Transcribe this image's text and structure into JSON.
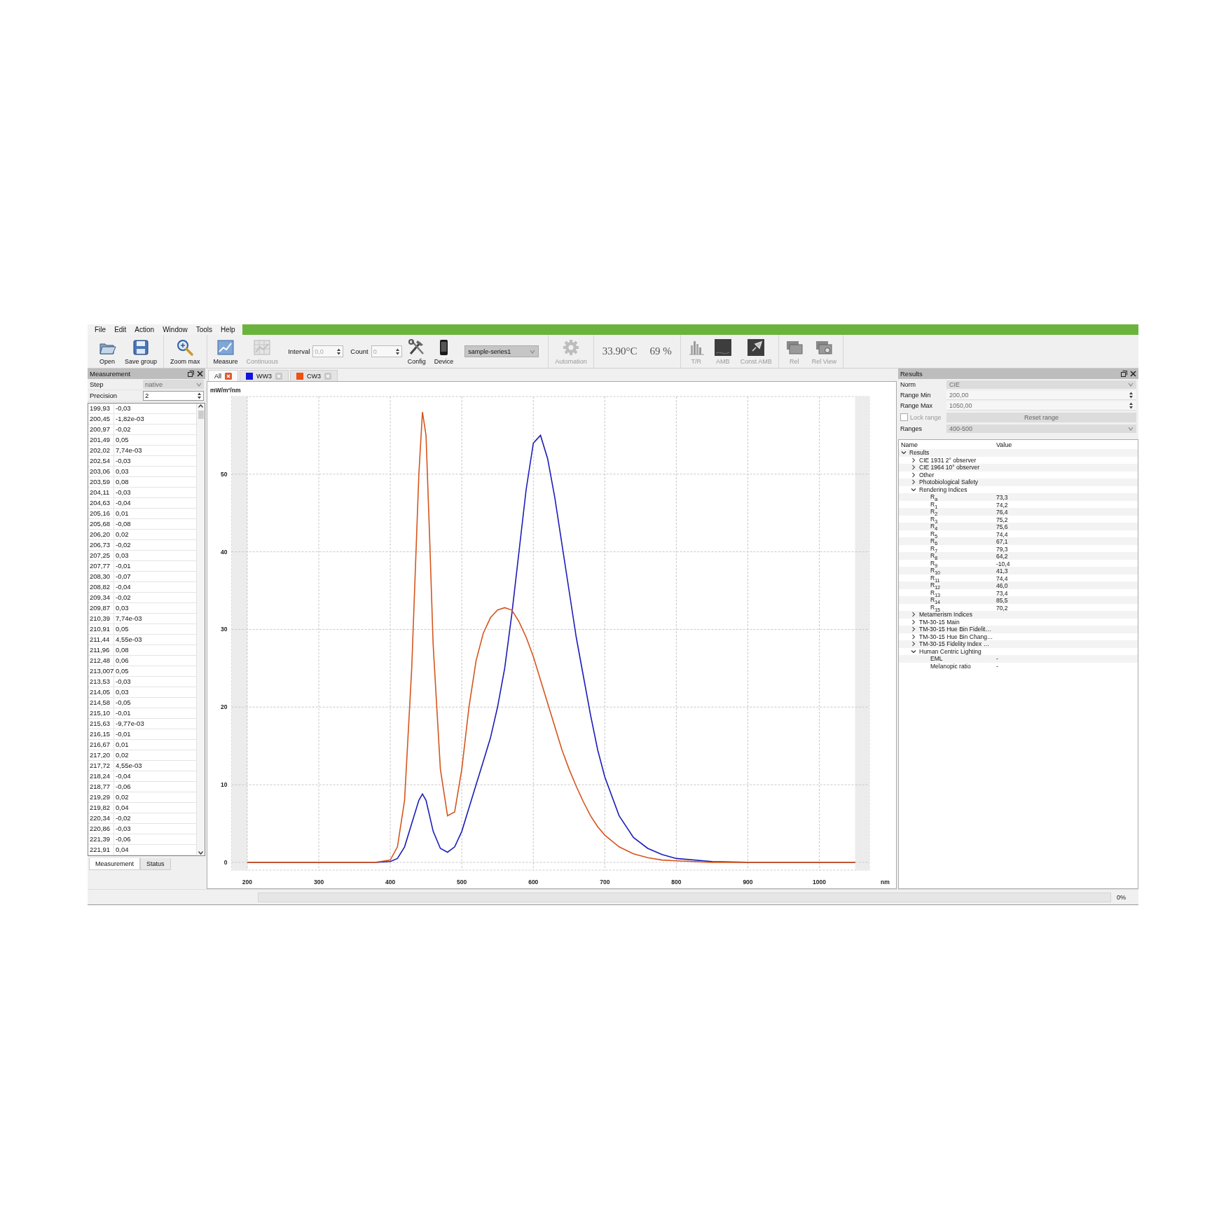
{
  "menu": [
    "File",
    "Edit",
    "Action",
    "Window",
    "Tools",
    "Help"
  ],
  "toolbar": [
    [
      {
        "kind": "button",
        "label": "Open",
        "disabled": false
      },
      {
        "kind": "button",
        "label": "Save group",
        "disabled": false
      }
    ],
    [
      {
        "kind": "button",
        "label": "Zoom max",
        "disabled": false
      }
    ],
    [
      {
        "kind": "button",
        "label": "Measure",
        "disabled": false
      },
      {
        "kind": "button",
        "label": "Continuous",
        "disabled": true
      },
      {
        "kind": "spin",
        "label": "Interval",
        "value": "0,0",
        "disabled": true
      },
      {
        "kind": "spin",
        "label": "Count",
        "value": "0",
        "disabled": true
      },
      {
        "kind": "button",
        "label": "Config",
        "disabled": false
      },
      {
        "kind": "button",
        "label": "Device",
        "disabled": false
      },
      {
        "kind": "combo",
        "value": "sample-series1"
      }
    ],
    [
      {
        "kind": "button",
        "label": "Automation",
        "disabled": true
      }
    ],
    [
      {
        "kind": "reading",
        "text": "33.90°C"
      },
      {
        "kind": "reading",
        "text": "69 %"
      }
    ],
    [
      {
        "kind": "button",
        "label": "T/R",
        "disabled": true
      },
      {
        "kind": "button",
        "label": "AMB",
        "disabled": true
      },
      {
        "kind": "button",
        "label": "Const AMB",
        "disabled": true
      }
    ],
    [
      {
        "kind": "button",
        "label": "Rel",
        "disabled": true
      },
      {
        "kind": "button",
        "label": "Rel View",
        "disabled": true
      }
    ]
  ],
  "measurement": {
    "title": "Measurement",
    "step_label": "Step",
    "step": "native",
    "precision_label": "Precision",
    "precision": "2",
    "rows": [
      [
        "199,93",
        "-0,03"
      ],
      [
        "200,45",
        "-1,82e-03"
      ],
      [
        "200,97",
        "-0,02"
      ],
      [
        "201,49",
        "0,05"
      ],
      [
        "202,02",
        "7,74e-03"
      ],
      [
        "202,54",
        "-0,03"
      ],
      [
        "203,06",
        "0,03"
      ],
      [
        "203,59",
        "0,08"
      ],
      [
        "204,11",
        "-0,03"
      ],
      [
        "204,63",
        "-0,04"
      ],
      [
        "205,16",
        "0,01"
      ],
      [
        "205,68",
        "-0,08"
      ],
      [
        "206,20",
        "0,02"
      ],
      [
        "206,73",
        "-0,02"
      ],
      [
        "207,25",
        "0,03"
      ],
      [
        "207,77",
        "-0,01"
      ],
      [
        "208,30",
        "-0,07"
      ],
      [
        "208,82",
        "-0,04"
      ],
      [
        "209,34",
        "-0,02"
      ],
      [
        "209,87",
        "0,03"
      ],
      [
        "210,39",
        "7,74e-03"
      ],
      [
        "210,91",
        "0,05"
      ],
      [
        "211,44",
        "4,55e-03"
      ],
      [
        "211,96",
        "0,08"
      ],
      [
        "212,48",
        "0,06"
      ],
      [
        "213,007",
        "0,05"
      ],
      [
        "213,53",
        "-0,03"
      ],
      [
        "214,05",
        "0,03"
      ],
      [
        "214,58",
        "-0,05"
      ],
      [
        "215,10",
        "-0,01"
      ],
      [
        "215,63",
        "-9,77e-03"
      ],
      [
        "216,15",
        "-0,01"
      ],
      [
        "216,67",
        "0,01"
      ],
      [
        "217,20",
        "0,02"
      ],
      [
        "217,72",
        "4,55e-03"
      ],
      [
        "218,24",
        "-0,04"
      ],
      [
        "218,77",
        "-0,06"
      ],
      [
        "219,29",
        "0,02"
      ],
      [
        "219,82",
        "0,04"
      ],
      [
        "220,34",
        "-0,02"
      ],
      [
        "220,86",
        "-0,03"
      ],
      [
        "221,39",
        "-0,06"
      ],
      [
        "221,91",
        "0,04"
      ]
    ],
    "tabs": [
      {
        "label": "Measurement",
        "selected": true
      },
      {
        "label": "Status",
        "selected": false
      }
    ]
  },
  "chart_tabs": [
    {
      "label": "All",
      "selected": true
    },
    {
      "label": "WW3",
      "selected": false,
      "color": "#1010e0"
    },
    {
      "label": "CW3",
      "selected": false,
      "color": "#f05010"
    }
  ],
  "chart": {
    "chart_data": {
      "type": "line",
      "ylabel": "mW/m²/nm",
      "xlabel": "nm",
      "x": [
        200,
        300,
        380,
        400,
        410,
        420,
        430,
        440,
        445,
        450,
        455,
        460,
        470,
        480,
        490,
        500,
        510,
        520,
        530,
        540,
        550,
        560,
        570,
        580,
        590,
        600,
        610,
        620,
        630,
        640,
        650,
        660,
        670,
        680,
        690,
        700,
        720,
        740,
        760,
        780,
        800,
        850,
        900,
        1000,
        1050
      ],
      "series": [
        {
          "color": "#1c1cb8",
          "values": [
            0,
            0,
            0,
            0.1,
            0.5,
            2,
            5,
            8,
            8.8,
            8,
            6,
            4,
            1.8,
            1.3,
            2,
            4,
            7,
            10,
            13,
            16,
            20,
            25,
            32,
            40,
            48,
            54,
            55,
            52,
            47,
            41,
            35,
            29,
            24,
            19,
            14.5,
            11,
            6,
            3.2,
            1.8,
            1,
            0.5,
            0.1,
            0,
            0,
            0
          ]
        },
        {
          "color": "#d4561e",
          "values": [
            0,
            0,
            0,
            0.3,
            2,
            8,
            25,
            50,
            58,
            55,
            42,
            28,
            12,
            6,
            6.5,
            12,
            20,
            26,
            29.5,
            31.5,
            32.5,
            32.8,
            32.5,
            31,
            29,
            26.5,
            23.5,
            20.5,
            17.5,
            14.5,
            12,
            9.8,
            7.8,
            6,
            4.6,
            3.5,
            2,
            1.1,
            0.6,
            0.3,
            0.2,
            0,
            0,
            0,
            0
          ]
        }
      ],
      "grid": true,
      "xlim": [
        178,
        1070
      ],
      "ylim": [
        -1,
        60
      ],
      "xticks": [
        200,
        300,
        400,
        500,
        600,
        700,
        800,
        900,
        1000
      ],
      "yticks": [
        0,
        10,
        20,
        30,
        40,
        50
      ]
    }
  },
  "results": {
    "title": "Results",
    "form": [
      {
        "kind": "combo",
        "label": "Norm",
        "value": "CIE"
      },
      {
        "kind": "spin",
        "label": "Range Min",
        "value": "200,00"
      },
      {
        "kind": "spin",
        "label": "Range Max",
        "value": "1050,00"
      },
      {
        "kind": "check",
        "label": "Lock range",
        "checked": false,
        "button": "Reset range"
      },
      {
        "kind": "combo",
        "label": "Ranges",
        "value": "400-500"
      }
    ],
    "columns": [
      "Name",
      "Value"
    ],
    "tree": [
      {
        "name": "Results",
        "expanded": true,
        "children": [
          {
            "name": "CIE 1931 2° observer",
            "expanded": false
          },
          {
            "name": "CIE 1964 10° observer",
            "expanded": false
          },
          {
            "name": "Other",
            "expanded": false
          },
          {
            "name": "Photobiological Safety",
            "expanded": false
          },
          {
            "name": "Rendering Indices",
            "expanded": true,
            "children": [
              {
                "name": "R$_{a}$",
                "value": "73,3"
              },
              {
                "name": "R$_{1}$",
                "value": "74,2"
              },
              {
                "name": "R$_{2}$",
                "value": "76,4"
              },
              {
                "name": "R$_{3}$",
                "value": "75,2"
              },
              {
                "name": "R$_{4}$",
                "value": "75,6"
              },
              {
                "name": "R$_{5}$",
                "value": "74,4"
              },
              {
                "name": "R$_{6}$",
                "value": "67,1"
              },
              {
                "name": "R$_{7}$",
                "value": "79,3"
              },
              {
                "name": "R$_{8}$",
                "value": "64,2"
              },
              {
                "name": "R$_{9}$",
                "value": "-10,4"
              },
              {
                "name": "R$_{10}$",
                "value": "41,3"
              },
              {
                "name": "R$_{11}$",
                "value": "74,4"
              },
              {
                "name": "R$_{12}$",
                "value": "46,0"
              },
              {
                "name": "R$_{13}$",
                "value": "73,4"
              },
              {
                "name": "R$_{14}$",
                "value": "85,5"
              },
              {
                "name": "R$_{15}$",
                "value": "70,2"
              }
            ]
          },
          {
            "name": "Metamerism Indices",
            "expanded": false
          },
          {
            "name": "TM-30-15 Main",
            "expanded": false
          },
          {
            "name": "TM-30-15 Hue Bin Fidelit…",
            "expanded": false
          },
          {
            "name": "TM-30-15 Hue Bin Chang…",
            "expanded": false
          },
          {
            "name": "TM-30-15 Fidelity Index …",
            "expanded": false
          },
          {
            "name": "Human Centric Lighting",
            "expanded": true,
            "children": [
              {
                "name": "EML",
                "value": "-"
              },
              {
                "name": "Melanopic ratio",
                "value": "-"
              }
            ]
          }
        ]
      }
    ]
  },
  "status": {
    "progress": {
      "level": 0,
      "text": "0%"
    }
  }
}
